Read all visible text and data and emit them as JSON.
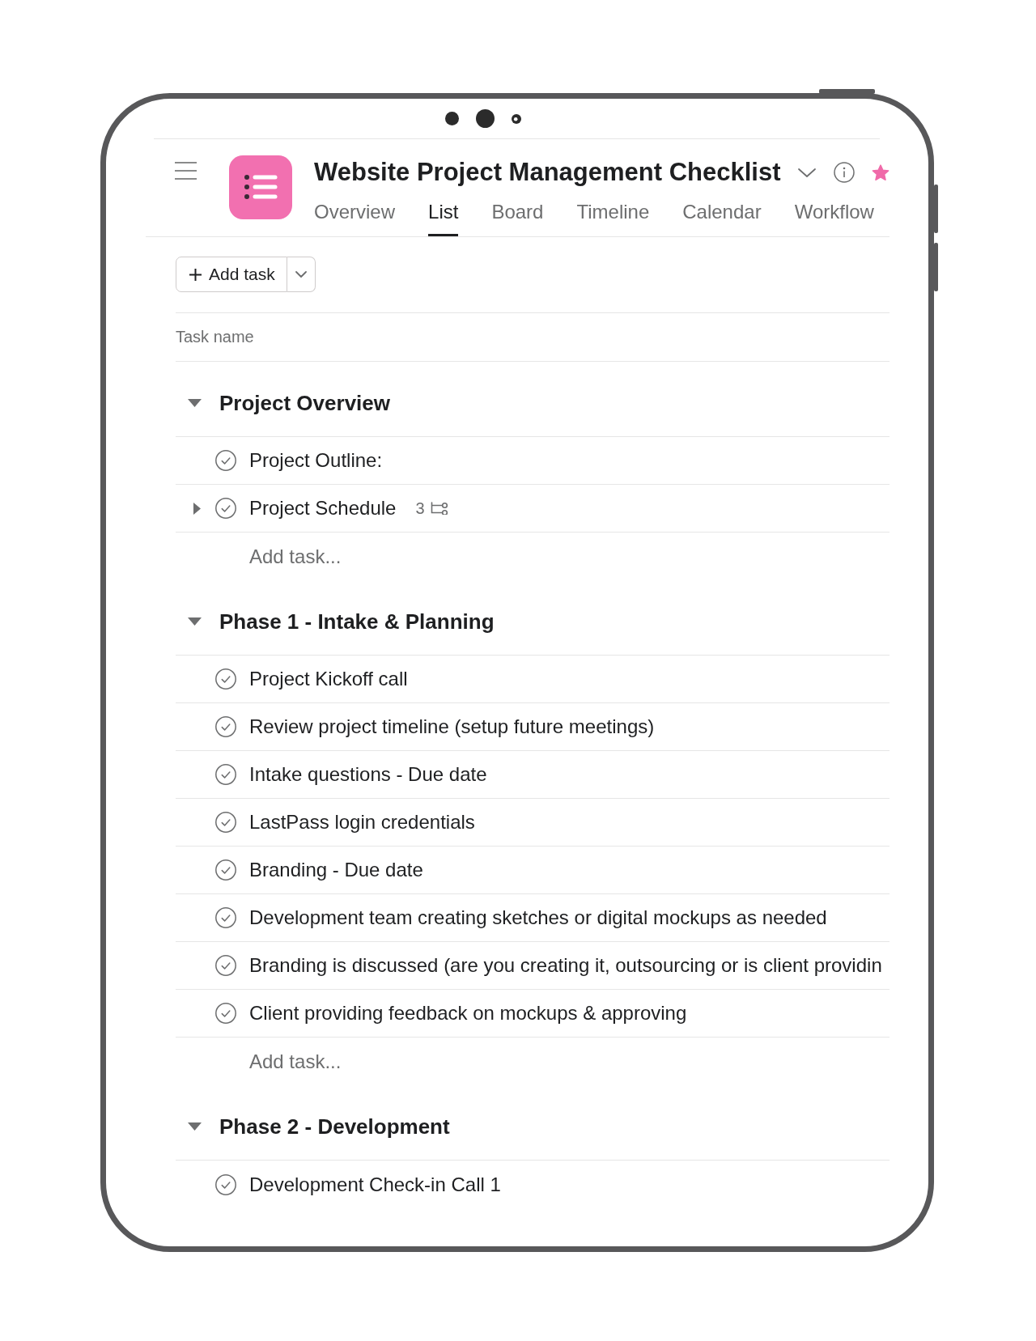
{
  "header": {
    "title": "Website Project Management Checklist",
    "starred": true
  },
  "tabs": [
    {
      "label": "Overview",
      "selected": false
    },
    {
      "label": "List",
      "selected": true
    },
    {
      "label": "Board",
      "selected": false
    },
    {
      "label": "Timeline",
      "selected": false
    },
    {
      "label": "Calendar",
      "selected": false
    },
    {
      "label": "Workflow",
      "selected": false
    }
  ],
  "toolbar": {
    "add_task": "Add task"
  },
  "columns": [
    "Task name"
  ],
  "sections": [
    {
      "title": "Project Overview",
      "expanded": true,
      "tasks": [
        {
          "name": "Project Outline:",
          "completed": false
        },
        {
          "name": "Project Schedule",
          "completed": false,
          "expanded": false,
          "subtask_count": "3"
        }
      ],
      "add_task": "Add task..."
    },
    {
      "title": "Phase 1 - Intake & Planning",
      "expanded": true,
      "tasks": [
        {
          "name": "Project Kickoff call",
          "completed": false
        },
        {
          "name": "Review project timeline (setup future meetings)",
          "completed": false
        },
        {
          "name": "Intake questions - Due date",
          "completed": false
        },
        {
          "name": "LastPass login credentials",
          "completed": false
        },
        {
          "name": "Branding - Due date",
          "completed": false
        },
        {
          "name": "Development team creating sketches or digital mockups as needed",
          "completed": false
        },
        {
          "name": "Branding is discussed (are you creating it, outsourcing or is client providin",
          "completed": false
        },
        {
          "name": "Client providing feedback on mockups & approving",
          "completed": false
        }
      ],
      "add_task": "Add task..."
    },
    {
      "title": "Phase 2 - Development",
      "expanded": true,
      "tasks": [
        {
          "name": "Development Check-in Call 1",
          "completed": false
        }
      ]
    }
  ]
}
